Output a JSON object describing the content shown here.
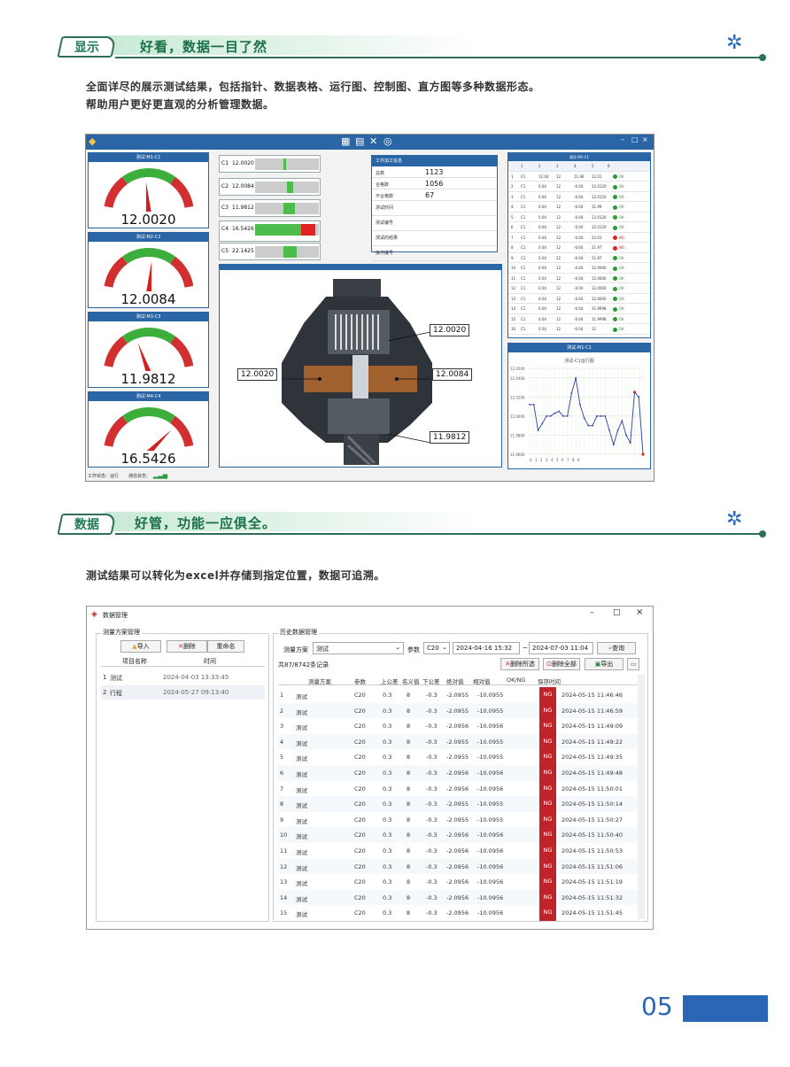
{
  "section1": {
    "tab": "显示",
    "title": "好看，数据一目了然"
  },
  "intro1": [
    "全面详尽的展示测试结果，包括指针、数据表格、运行图、控制图、直方图等多种数据形态。",
    "帮助用户更好更直观的分析管理数据。"
  ],
  "dashboard": {
    "gauges": [
      {
        "title": "测试-M1-C1",
        "value": "12.0020"
      },
      {
        "title": "测试-M2-C2",
        "value": "12.0084"
      },
      {
        "title": "测试-M3-C3",
        "value": "11.9812"
      },
      {
        "title": "测试-M4-C4",
        "value": "16.5426"
      }
    ],
    "bars": [
      {
        "label": "C1",
        "value": "12.0020"
      },
      {
        "label": "C2",
        "value": "12.0084"
      },
      {
        "label": "C3",
        "value": "11.9812"
      },
      {
        "label": "C4",
        "value": "16.5426"
      },
      {
        "label": "C5",
        "value": "22.1425"
      }
    ],
    "bar_levels": [
      0.45,
      0.5,
      0.55,
      0.72,
      0.5
    ],
    "info_title": "工件加工信息",
    "info_rows": [
      {
        "label": "总数",
        "value": "1123"
      },
      {
        "label": "合格数",
        "value": "1056"
      },
      {
        "label": "不合格数",
        "value": "67"
      },
      {
        "label": "测试时间",
        "value": ""
      },
      {
        "label": "测试编号",
        "value": ""
      },
      {
        "label": "测试的结果",
        "value": ""
      },
      {
        "label": "操作编号",
        "value": ""
      }
    ],
    "diagram_labels": [
      "12.0020",
      "12.0020",
      "12.0084",
      "11.9812"
    ],
    "table_title": "测试-M1-C1",
    "table_headers": [
      "1",
      "2",
      "3",
      "4",
      "5",
      "6"
    ],
    "table_rows": [
      [
        "1",
        "C1",
        "12.04",
        "12",
        "11.96",
        "12.01",
        "OK"
      ],
      [
        "2",
        "C1",
        "0.04",
        "12",
        "-0.04",
        "12.0120",
        "OK"
      ],
      [
        "3",
        "C1",
        "0.04",
        "12",
        "-0.04",
        "12.0120",
        "OK"
      ],
      [
        "4",
        "C1",
        "0.04",
        "12",
        "-0.04",
        "11.99",
        "OK"
      ],
      [
        "5",
        "C1",
        "0.04",
        "12",
        "-0.04",
        "12.0120",
        "OK"
      ],
      [
        "6",
        "C1",
        "0.04",
        "12",
        "-0.04",
        "12.0120",
        "OK"
      ],
      [
        "7",
        "C1",
        "0.04",
        "12",
        "-0.04",
        "22.01",
        "NG"
      ],
      [
        "8",
        "C1",
        "0.04",
        "12",
        "-0.04",
        "21.97",
        "NG"
      ],
      [
        "9",
        "C1",
        "0.04",
        "12",
        "-0.04",
        "11.97",
        "OK"
      ],
      [
        "10",
        "C1",
        "0.04",
        "12",
        "-0.04",
        "12.0000",
        "OK"
      ],
      [
        "11",
        "C1",
        "0.04",
        "12",
        "-0.04",
        "12.0000",
        "OK"
      ],
      [
        "12",
        "C1",
        "0.04",
        "12",
        "-0.04",
        "12.0000",
        "OK"
      ],
      [
        "13",
        "C1",
        "0.04",
        "12",
        "-0.04",
        "12.0000",
        "OK"
      ],
      [
        "14",
        "C1",
        "0.04",
        "12",
        "-0.04",
        "11.9998",
        "OK"
      ],
      [
        "15",
        "C1",
        "0.04",
        "12",
        "-0.04",
        "11.9998",
        "OK"
      ],
      [
        "16",
        "C1",
        "0.04",
        "12",
        "-0.04",
        "12",
        "OK"
      ]
    ],
    "chart_title": "测试-M1-C1",
    "chart_subtitle": "测试-C1运行图",
    "status_left": "工作状态：运行",
    "status_right": "通信状态："
  },
  "chart_data": {
    "type": "line",
    "title": "测试-C1运行图",
    "x": [
      0,
      1,
      2,
      3,
      4,
      5,
      6,
      7,
      8,
      9,
      10,
      11,
      12,
      13,
      14,
      15,
      16,
      17,
      18,
      19,
      20,
      21,
      22,
      23,
      24,
      25,
      26,
      27
    ],
    "y": [
      12.012,
      12.012,
      11.985,
      11.992,
      12.0,
      12.0,
      12.003,
      12.005,
      12.0,
      12.0,
      12.024,
      12.04,
      12.012,
      11.998,
      11.99,
      11.99,
      12.0,
      12.0,
      12.0,
      11.985,
      11.97,
      11.985,
      11.995,
      11.98,
      11.972,
      12.025,
      12.02,
      11.96
    ],
    "ylim": [
      11.96,
      12.05
    ],
    "yticks": [
      "12.0500",
      "12.0400",
      "12.0200",
      "12.0000",
      "11.9800",
      "11.9600"
    ],
    "grid": true
  },
  "section2": {
    "tab": "数据",
    "title": "好管，功能一应俱全。"
  },
  "intro2": "测试结果可以转化为excel并存储到指定位置，数据可追溯。",
  "datamgr": {
    "window_title": "数据管理",
    "left_group": "测量方案管理",
    "btn_import": "导入",
    "btn_delete": "删除",
    "btn_rename": "重命名",
    "left_headers": [
      "项目名称",
      "时间"
    ],
    "left_rows": [
      {
        "idx": "1",
        "name": "测试",
        "time": "2024-04-03 13:33:45"
      },
      {
        "idx": "2",
        "name": "行程",
        "time": "2024-05-27 09:13:40"
      }
    ],
    "right_group": "历史数据管理",
    "filter_label": "测量方案",
    "filter_value": "测试",
    "param_label": "参数",
    "param_value": "C20",
    "date_from": "2024-04-16 15:32",
    "date_to": "2024-07-03 11:04",
    "btn_query": "查询",
    "count_text": "共87/8742条记录",
    "btn_delete_selected": "删除所选",
    "btn_delete_all": "删除全部",
    "btn_export": "导出",
    "headers": [
      "测量方案",
      "参数",
      "上公差",
      "名义值",
      "下公差",
      "绝对值",
      "相对值",
      "OK/NG",
      "保存时间"
    ],
    "rows": [
      [
        "1",
        "测试",
        "C20",
        "0.3",
        "8",
        "-0.3",
        "-2.0955",
        "-10.0955",
        "NG",
        "2024-05-15 11:46:46"
      ],
      [
        "2",
        "测试",
        "C20",
        "0.3",
        "8",
        "-0.3",
        "-2.0955",
        "-10.0955",
        "NG",
        "2024-05-15 11:46:59"
      ],
      [
        "3",
        "测试",
        "C20",
        "0.3",
        "8",
        "-0.3",
        "-2.0956",
        "-10.0956",
        "NG",
        "2024-05-15 11:49:09"
      ],
      [
        "4",
        "测试",
        "C20",
        "0.3",
        "8",
        "-0.3",
        "-2.0955",
        "-10.0955",
        "NG",
        "2024-05-15 11:49:22"
      ],
      [
        "5",
        "测试",
        "C20",
        "0.3",
        "8",
        "-0.3",
        "-2.0955",
        "-10.0955",
        "NG",
        "2024-05-15 11:49:35"
      ],
      [
        "6",
        "测试",
        "C20",
        "0.3",
        "8",
        "-0.3",
        "-2.0956",
        "-10.0956",
        "NG",
        "2024-05-15 11:49:48"
      ],
      [
        "7",
        "测试",
        "C20",
        "0.3",
        "8",
        "-0.3",
        "-2.0956",
        "-10.0956",
        "NG",
        "2024-05-15 11:50:01"
      ],
      [
        "8",
        "测试",
        "C20",
        "0.3",
        "8",
        "-0.3",
        "-2.0955",
        "-10.0955",
        "NG",
        "2024-05-15 11:50:14"
      ],
      [
        "9",
        "测试",
        "C20",
        "0.3",
        "8",
        "-0.3",
        "-2.0955",
        "-10.0955",
        "NG",
        "2024-05-15 11:50:27"
      ],
      [
        "10",
        "测试",
        "C20",
        "0.3",
        "8",
        "-0.3",
        "-2.0956",
        "-10.0956",
        "NG",
        "2024-05-15 11:50:40"
      ],
      [
        "11",
        "测试",
        "C20",
        "0.3",
        "8",
        "-0.3",
        "-2.0956",
        "-10.0956",
        "NG",
        "2024-05-15 11:50:53"
      ],
      [
        "12",
        "测试",
        "C20",
        "0.3",
        "8",
        "-0.3",
        "-2.0956",
        "-10.0956",
        "NG",
        "2024-05-15 11:51:06"
      ],
      [
        "13",
        "测试",
        "C20",
        "0.3",
        "8",
        "-0.3",
        "-2.0956",
        "-10.0956",
        "NG",
        "2024-05-15 11:51:19"
      ],
      [
        "14",
        "测试",
        "C20",
        "0.3",
        "8",
        "-0.3",
        "-2.0956",
        "-10.0956",
        "NG",
        "2024-05-15 11:51:32"
      ],
      [
        "15",
        "测试",
        "C20",
        "0.3",
        "8",
        "-0.3",
        "-2.0956",
        "-10.0956",
        "NG",
        "2024-05-15 11:51:45"
      ]
    ]
  },
  "page_number": "05",
  "colors": {
    "brand_green": "#1f7a55",
    "brand_blue": "#2a66a5",
    "ng_red": "#c1232b"
  }
}
